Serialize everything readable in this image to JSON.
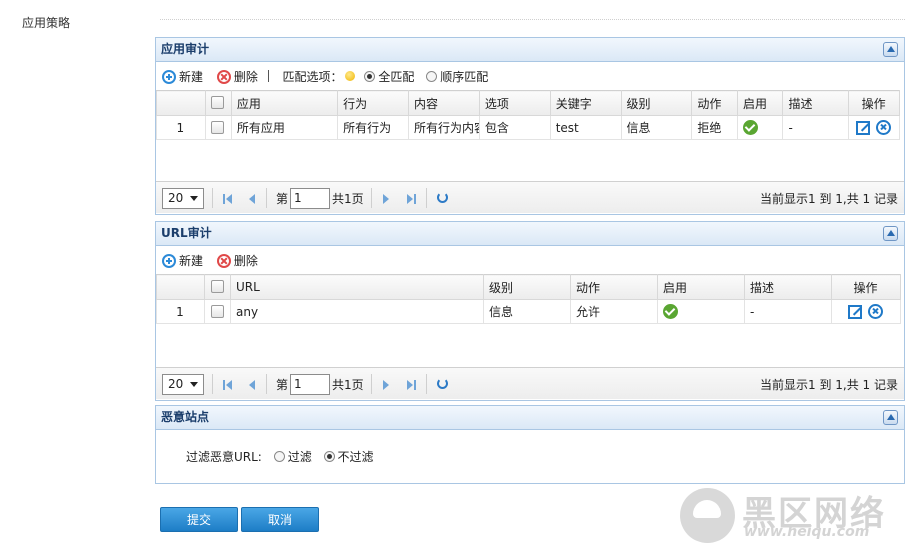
{
  "page": {
    "title": "应用策略"
  },
  "app_audit": {
    "title": "应用审计",
    "toolbar": {
      "add": "新建",
      "delete": "删除",
      "match_label": "匹配选项：",
      "match_all": "全匹配",
      "match_seq": "顺序匹配"
    },
    "columns": [
      "应用",
      "行为",
      "内容",
      "选项",
      "关键字",
      "级别",
      "动作",
      "启用",
      "描述",
      "操作"
    ],
    "rows": [
      {
        "num": "1",
        "app": "所有应用",
        "behavior": "所有行为",
        "content": "所有行为内容",
        "option": "包含",
        "keyword": "test",
        "level": "信息",
        "action": "拒绝",
        "desc": "-"
      }
    ],
    "pager": {
      "page_size": "20",
      "page_prefix": "第",
      "page_value": "1",
      "total_pages": "共1页",
      "info": "当前显示1 到 1,共 1 记录"
    }
  },
  "url_audit": {
    "title": "URL审计",
    "toolbar": {
      "add": "新建",
      "delete": "删除"
    },
    "columns": [
      "URL",
      "级别",
      "动作",
      "启用",
      "描述",
      "操作"
    ],
    "rows": [
      {
        "num": "1",
        "url": "any",
        "level": "信息",
        "action": "允许",
        "desc": "-"
      }
    ],
    "pager": {
      "page_size": "20",
      "page_prefix": "第",
      "page_value": "1",
      "total_pages": "共1页",
      "info": "当前显示1 到 1,共 1 记录"
    }
  },
  "malicious": {
    "title": "恶意站点",
    "label": "过滤恶意URL:",
    "filter": "过滤",
    "no_filter": "不过滤"
  },
  "buttons": {
    "submit": "提交",
    "cancel": "取消"
  },
  "watermark": {
    "text": "黑区网络",
    "url": "www.heiqu.com"
  }
}
